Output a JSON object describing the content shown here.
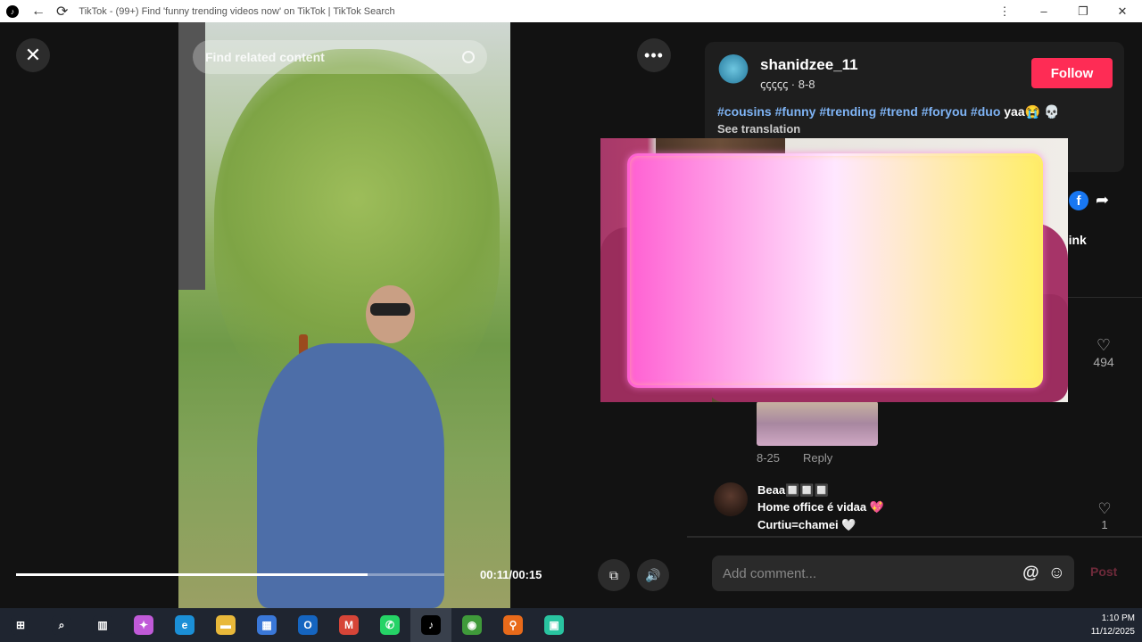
{
  "window": {
    "title": "TikTok - (99+) Find 'funny trending videos now' on TikTok | TikTok Search",
    "back_glyph": "←",
    "reload_glyph": "⟳",
    "menu_glyph": "⋮",
    "min_glyph": "–",
    "max_glyph": "❐",
    "close_glyph": "✕"
  },
  "video": {
    "search_placeholder": "Find related content",
    "close_glyph": "✕",
    "more_glyph": "•••",
    "progress_fraction": 0.82,
    "timecode": "00:11/00:15",
    "pip_glyph": "⧉",
    "volume_glyph": "🔊"
  },
  "post": {
    "username": "shanidzee_11",
    "subline": "ꞔꞔꞔꞔꞔ · 8-8",
    "follow_label": "Follow",
    "hashtags": "#cousins #funny #trending #trend #foryou #duo",
    "caption_tail": " yaa😭 💀",
    "see_translation": "See translation",
    "copy_link": "y link",
    "fb_glyph": "f",
    "share_glyph": "➦"
  },
  "comments": {
    "like1_count": "494",
    "heart_glyph": "♡",
    "c1_date": "8-25",
    "c1_reply": "Reply",
    "c2_name": "Beaa🔲🔲🔲",
    "c2_line1": "Home office é vidaa 💖",
    "c2_line2": "Curtiu=chamei 🤍",
    "like2_count": "1",
    "input_placeholder": "Add comment...",
    "at_glyph": "@",
    "emoji_glyph": "☺",
    "post_label": "Post"
  },
  "taskbar": {
    "items": [
      {
        "name": "windows-start-icon",
        "glyph": "⊞",
        "color": "#1f2530"
      },
      {
        "name": "search-icon",
        "glyph": "⌕",
        "color": "#1f2530"
      },
      {
        "name": "task-view-icon",
        "glyph": "▥",
        "color": "#1f2530"
      },
      {
        "name": "copilot-icon",
        "glyph": "✦",
        "color": "#c05ad8"
      },
      {
        "name": "edge-icon",
        "glyph": "e",
        "color": "#1b8fd6"
      },
      {
        "name": "file-explorer-icon",
        "glyph": "▬",
        "color": "#e8b83a"
      },
      {
        "name": "store-icon",
        "glyph": "▦",
        "color": "#3a78d8"
      },
      {
        "name": "outlook-icon",
        "glyph": "O",
        "color": "#1565c0"
      },
      {
        "name": "gmail-icon",
        "glyph": "M",
        "color": "#d64538"
      },
      {
        "name": "whatsapp-icon",
        "glyph": "✆",
        "color": "#25d366"
      },
      {
        "name": "tiktok-icon",
        "glyph": "♪",
        "color": "#000000"
      },
      {
        "name": "chrome-icon",
        "glyph": "◉",
        "color": "#3f9a3a"
      },
      {
        "name": "magnifier-app-icon",
        "glyph": "⚲",
        "color": "#e86a1a"
      },
      {
        "name": "recorder-app-icon",
        "glyph": "▣",
        "color": "#29c4a0"
      }
    ],
    "time": "1:10 PM",
    "date": "11/12/2025"
  }
}
